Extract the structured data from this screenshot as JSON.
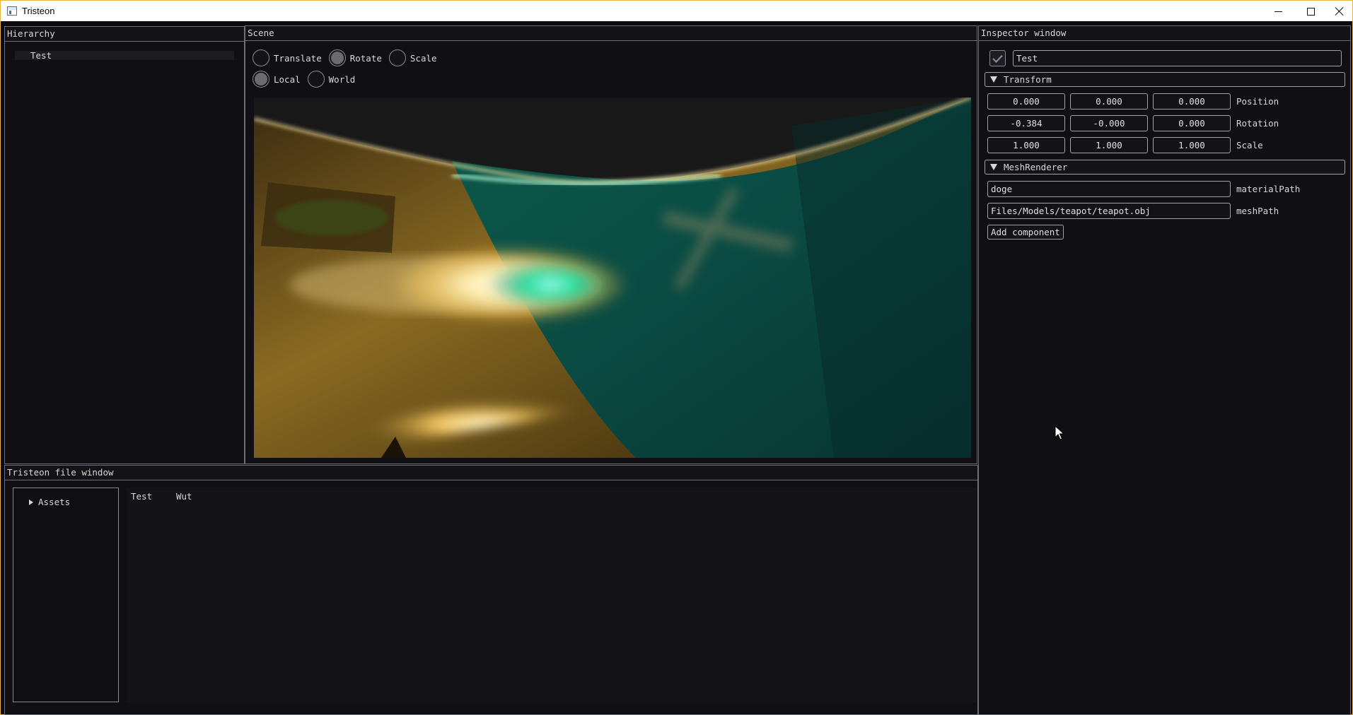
{
  "window": {
    "title": "Tristeon",
    "controls": {
      "minimize_icon": "minimize-icon",
      "maximize_icon": "maximize-icon",
      "close_icon": "close-icon"
    },
    "accent_border": "#e8b640"
  },
  "hierarchy": {
    "title": "Hierarchy",
    "items": [
      {
        "label": "Test",
        "selected": true
      }
    ]
  },
  "scene": {
    "title": "Scene",
    "gizmo_modes": [
      {
        "label": "Translate",
        "selected": false
      },
      {
        "label": "Rotate",
        "selected": true
      },
      {
        "label": "Scale",
        "selected": false
      }
    ],
    "space_modes": [
      {
        "label": "Local",
        "selected": true
      },
      {
        "label": "World",
        "selected": false
      }
    ]
  },
  "inspector": {
    "title": "Inspector window",
    "object": {
      "enabled": true,
      "name": "Test"
    },
    "transform": {
      "header": "Transform",
      "position": {
        "label": "Position",
        "x": "0.000",
        "y": "0.000",
        "z": "0.000"
      },
      "rotation": {
        "label": "Rotation",
        "x": "-0.384",
        "y": "-0.000",
        "z": "0.000"
      },
      "scale": {
        "label": "Scale",
        "x": "1.000",
        "y": "1.000",
        "z": "1.000"
      }
    },
    "mesh_renderer": {
      "header": "MeshRenderer",
      "material_path": {
        "label": "materialPath",
        "value": "doge"
      },
      "mesh_path": {
        "label": "meshPath",
        "value": "Files/Models/teapot/teapot.obj"
      }
    },
    "add_component_label": "Add component"
  },
  "file_window": {
    "title": "Tristeon file window",
    "tree": [
      {
        "label": "Assets",
        "expanded": false
      }
    ],
    "files": [
      "Test",
      "Wut"
    ]
  }
}
